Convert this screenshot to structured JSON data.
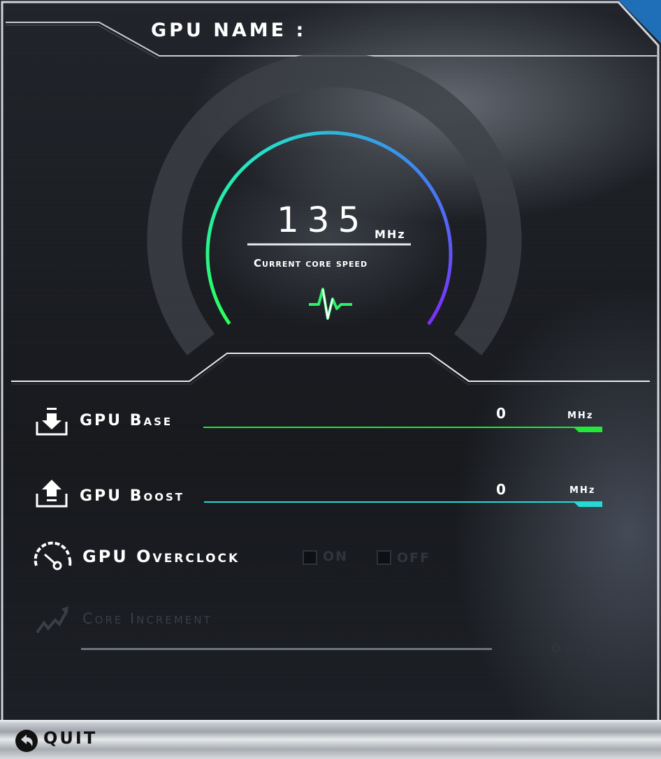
{
  "header": {
    "title": "GPU NAME :"
  },
  "gauge": {
    "value": "135",
    "unit": "MHz",
    "caption": "Current core speed",
    "arc_colors": [
      "#2cff5a",
      "#23e6c4",
      "#3a8cf0",
      "#7b2ff7"
    ]
  },
  "controls": {
    "gpu_base": {
      "label": "GPU Base",
      "value": "0",
      "unit": "MHz",
      "color": "#23e83a",
      "icon": "download-icon"
    },
    "gpu_boost": {
      "label": "GPU Boost",
      "value": "0",
      "unit": "MHz",
      "color": "#24d9d6",
      "icon": "upload-icon"
    },
    "gpu_overclock": {
      "label": "GPU Overclock",
      "icon": "speedometer-icon",
      "on_label": "ON",
      "off_label": "OFF"
    },
    "core_increment": {
      "label": "Core Increment",
      "value": "0",
      "unit": "MHz",
      "icon": "trend-up-icon"
    }
  },
  "footer": {
    "quit_label": "QUIT",
    "icon": "back-arrow-icon"
  }
}
